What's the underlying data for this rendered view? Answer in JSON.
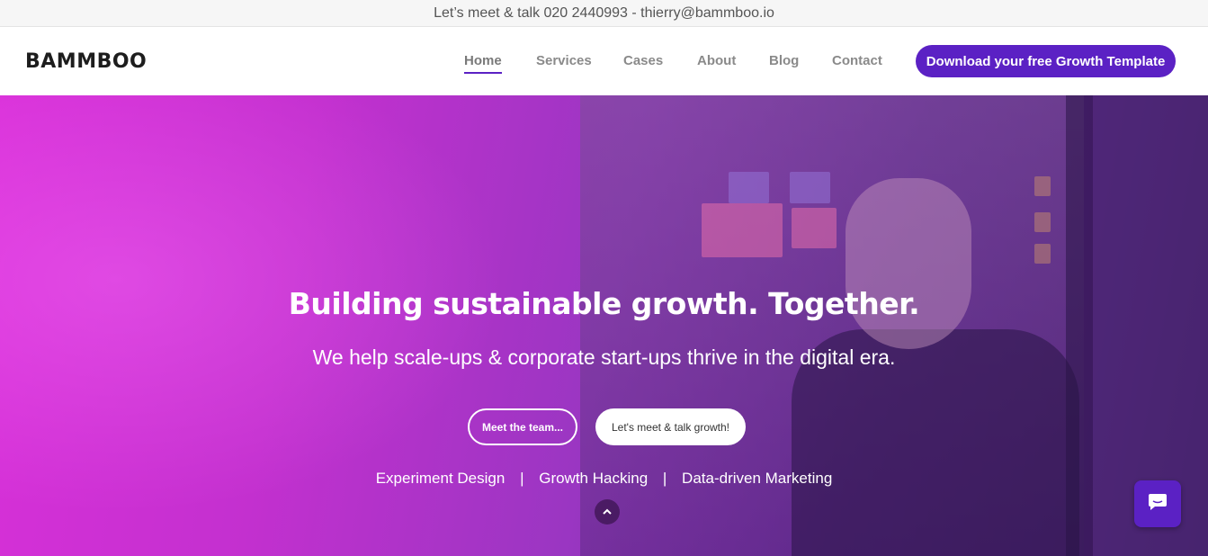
{
  "topbar": {
    "text": "Let’s meet & talk 020 2440993 - thierry@bammboo.io"
  },
  "header": {
    "logo": "BAMMBOO",
    "nav": [
      {
        "label": "Home",
        "active": true
      },
      {
        "label": "Services",
        "active": false
      },
      {
        "label": "Cases",
        "active": false
      },
      {
        "label": "About",
        "active": false
      },
      {
        "label": "Blog",
        "active": false
      },
      {
        "label": "Contact",
        "active": false
      }
    ],
    "cta_label": "Download your free Growth Template"
  },
  "hero": {
    "title": "Building sustainable growth. Together.",
    "subtitle": "We help scale-ups & corporate start-ups thrive in the digital era.",
    "btn_team": "Meet the team...",
    "btn_talk": "Let's meet & talk growth!",
    "tags": [
      "Experiment Design",
      "Growth Hacking",
      "Data-driven Marketing"
    ],
    "tag_separator": "|",
    "scroll_icon": "chevron-up-icon"
  },
  "chat": {
    "icon": "chat-bubble-icon"
  },
  "colors": {
    "brand_purple": "#5b21c4",
    "hero_magenta": "#d930d9"
  }
}
